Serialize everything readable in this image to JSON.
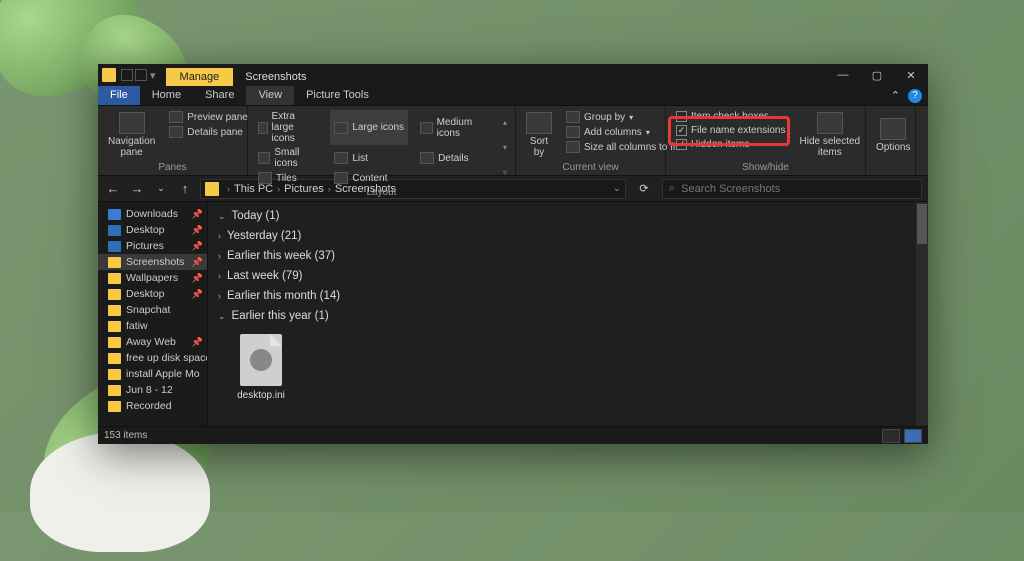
{
  "window": {
    "contextual_tab": "Manage",
    "title": "Screenshots",
    "controls": {
      "min": "—",
      "max": "▢",
      "close": "✕"
    }
  },
  "menu": {
    "file": "File",
    "items": [
      "Home",
      "Share",
      "View",
      "Picture Tools"
    ],
    "active_index": 2,
    "collapse": "⌃",
    "help": "?"
  },
  "ribbon": {
    "panes": {
      "nav": "Navigation\npane",
      "preview": "Preview pane",
      "details": "Details pane",
      "label": "Panes"
    },
    "layout": {
      "options": [
        "Extra large icons",
        "Large icons",
        "Medium icons",
        "Small icons",
        "List",
        "Details",
        "Tiles",
        "Content"
      ],
      "selected_index": 1,
      "label": "Layout"
    },
    "current": {
      "sort": "Sort\nby",
      "group": "Group by",
      "add_cols": "Add columns",
      "size_cols": "Size all columns to fit",
      "label": "Current view"
    },
    "showhide": {
      "checkboxes": "Item check boxes",
      "extensions": "File name extensions",
      "hidden": "Hidden items",
      "hide_btn": "Hide selected\nitems",
      "label": "Show/hide",
      "checkboxes_checked": false,
      "extensions_checked": true,
      "hidden_checked": true
    },
    "options": "Options"
  },
  "nav": {
    "back": "←",
    "forward": "→",
    "recent": "⌄",
    "up": "↑",
    "crumbs": [
      "This PC",
      "Pictures",
      "Screenshots"
    ],
    "refresh": "⟳",
    "search_placeholder": "Search Screenshots"
  },
  "sidebar": [
    {
      "icon": "dl",
      "label": "Downloads",
      "pinned": true
    },
    {
      "icon": "desk",
      "label": "Desktop",
      "pinned": true
    },
    {
      "icon": "pic",
      "label": "Pictures",
      "pinned": true
    },
    {
      "icon": "",
      "label": "Screenshots",
      "pinned": true,
      "selected": true
    },
    {
      "icon": "",
      "label": "Wallpapers",
      "pinned": true
    },
    {
      "icon": "",
      "label": "Desktop",
      "pinned": true
    },
    {
      "icon": "",
      "label": "Snapchat",
      "pinned": false
    },
    {
      "icon": "",
      "label": "fatiw",
      "pinned": false
    },
    {
      "icon": "",
      "label": "Away Web",
      "pinned": true
    },
    {
      "icon": "",
      "label": "free up disk space",
      "pinned": false
    },
    {
      "icon": "",
      "label": "install Apple Mo",
      "pinned": false
    },
    {
      "icon": "",
      "label": "Jun 8 - 12",
      "pinned": false
    },
    {
      "icon": "",
      "label": "Recorded",
      "pinned": false
    }
  ],
  "groups": [
    {
      "label": "Today (1)",
      "expanded": true
    },
    {
      "label": "Yesterday (21)",
      "expanded": false
    },
    {
      "label": "Earlier this week (37)",
      "expanded": false
    },
    {
      "label": "Last week (79)",
      "expanded": false
    },
    {
      "label": "Earlier this month (14)",
      "expanded": false
    },
    {
      "label": "Earlier this year (1)",
      "expanded": true
    }
  ],
  "file": {
    "name": "desktop.ini"
  },
  "status": {
    "count": "153 items"
  }
}
